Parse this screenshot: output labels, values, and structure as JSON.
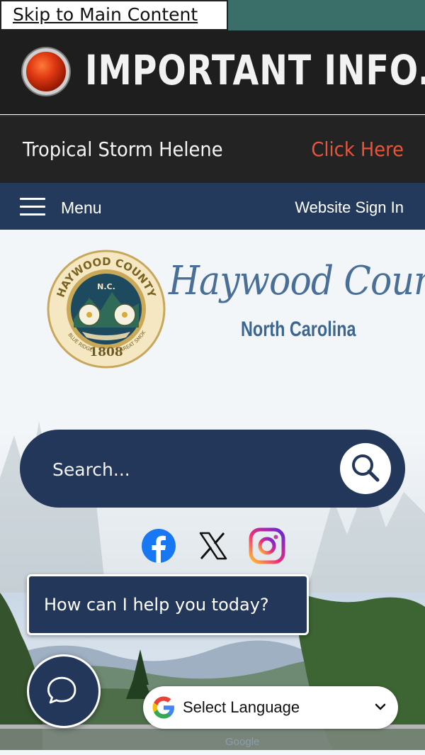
{
  "skip_link": {
    "label": "Skip to Main Content"
  },
  "alert": {
    "title": "IMPORTANT INFO.",
    "message": "Tropical Storm Helene",
    "link_label": "Click Here",
    "link_color": "#e8553a"
  },
  "nav": {
    "menu_label": "Menu",
    "sign_in_label": "Website Sign In",
    "background": "#233a5c"
  },
  "brand": {
    "name_script": "Haywood County",
    "state": "North Carolina",
    "seal": {
      "top_text": "HAYWOOD COUNTY",
      "abbrev": "N.C.",
      "year": "1808",
      "left_text": "BLUE RIDGE",
      "right_text": "GREAT SMOKIES"
    }
  },
  "search": {
    "placeholder": "Search..."
  },
  "social": [
    {
      "name": "facebook-icon"
    },
    {
      "name": "x-icon"
    },
    {
      "name": "instagram-icon"
    }
  ],
  "chat": {
    "prompt": "How can I help you today?"
  },
  "translate": {
    "selected": "Select Language",
    "options": [
      "Select Language"
    ],
    "powered_by": "Google"
  }
}
